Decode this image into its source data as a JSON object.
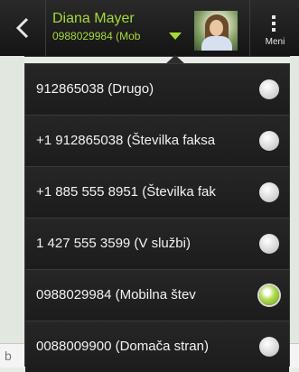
{
  "header": {
    "contact_name": "Diana Mayer",
    "contact_number": "0988029984 (Mob",
    "menu_label": "Meni",
    "accent_color": "#a6d936"
  },
  "popup": {
    "items": [
      {
        "label": "912865038 (Drugo)",
        "selected": false
      },
      {
        "label": "+1 912865038 (Številka faksa",
        "selected": false
      },
      {
        "label": "+1 885 555 8951 (Številka fak",
        "selected": false
      },
      {
        "label": "1 427 555 3599 (V službi)",
        "selected": false
      },
      {
        "label": "0988029984 (Mobilna štev",
        "selected": true
      },
      {
        "label": "0088009900 (Domača stran)",
        "selected": false
      }
    ]
  },
  "composer": {
    "partial_text": "b"
  }
}
